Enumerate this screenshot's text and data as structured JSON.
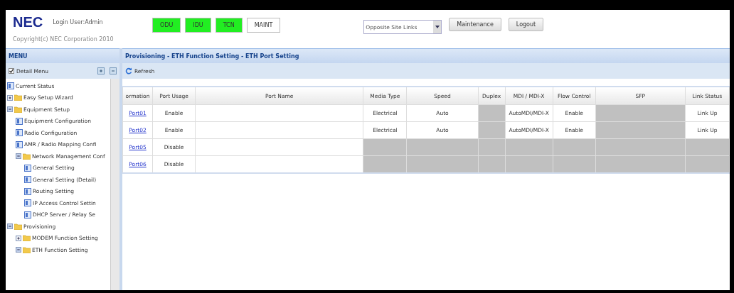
{
  "header": {
    "logo": "NEC",
    "login": "Login User:Admin",
    "copyright": "Copyright(c) NEC Corporation 2010",
    "badges": [
      {
        "label": "ODU",
        "color": "#22ee22"
      },
      {
        "label": "IDU",
        "color": "#22ee22"
      },
      {
        "label": "TCN",
        "color": "#22ee22"
      },
      {
        "label": "MAINT",
        "color": "#ffffff"
      }
    ],
    "site_select": {
      "value": "Opposite Site Links"
    },
    "buttons": [
      "Maintenance",
      "Logout"
    ]
  },
  "sidebar": {
    "title": "MENU",
    "detail_menu": {
      "label": "Detail Menu",
      "checked": true
    },
    "tree": [
      {
        "label": "Current Status",
        "kind": "page"
      },
      {
        "label": "Easy Setup Wizard",
        "kind": "folder",
        "expanded": false
      },
      {
        "label": "Equipment Setup",
        "kind": "folder",
        "expanded": true,
        "children": [
          {
            "label": "Equipment Configuration",
            "kind": "page"
          },
          {
            "label": "Radio Configuration",
            "kind": "page"
          },
          {
            "label": "AMR / Radio Mapping Confi",
            "kind": "page"
          },
          {
            "label": "Network Management Conf",
            "kind": "folder",
            "expanded": true,
            "children": [
              {
                "label": "General Setting",
                "kind": "page"
              },
              {
                "label": "General Setting (Detail)",
                "kind": "page"
              },
              {
                "label": "Routing Setting",
                "kind": "page"
              },
              {
                "label": "IP Access Control Settin",
                "kind": "page"
              },
              {
                "label": "DHCP Server / Relay Se",
                "kind": "page"
              }
            ]
          }
        ]
      },
      {
        "label": "Provisioning",
        "kind": "folder",
        "expanded": true,
        "children": [
          {
            "label": "MODEM Function Setting",
            "kind": "folder",
            "expanded": false
          },
          {
            "label": "ETH Function Setting",
            "kind": "folder",
            "expanded": true
          }
        ]
      }
    ]
  },
  "main": {
    "breadcrumb": "Provisioning - ETH Function Setting - ETH Port Setting",
    "refresh": "Refresh",
    "table": {
      "columns": [
        "ormation",
        "Port Usage",
        "Port Name",
        "Media Type",
        "Speed",
        "Duplex",
        "MDI / MDI-X",
        "Flow Control",
        "SFP",
        "Link Status"
      ],
      "rows": [
        {
          "cells": [
            {
              "text": "Port01",
              "kind": "link"
            },
            {
              "text": "Enable"
            },
            {
              "text": ""
            },
            {
              "text": "Electrical"
            },
            {
              "text": "Auto"
            },
            {
              "disabled": true
            },
            {
              "text": "AutoMDI/MDI-X"
            },
            {
              "text": "Enable"
            },
            {
              "disabled": true
            },
            {
              "text": "Link Up"
            }
          ]
        },
        {
          "cells": [
            {
              "text": "Port02",
              "kind": "link"
            },
            {
              "text": "Enable"
            },
            {
              "text": ""
            },
            {
              "text": "Electrical"
            },
            {
              "text": "Auto"
            },
            {
              "disabled": true
            },
            {
              "text": "AutoMDI/MDI-X"
            },
            {
              "text": "Enable"
            },
            {
              "disabled": true
            },
            {
              "text": "Link Up"
            }
          ]
        },
        {
          "cells": [
            {
              "text": "Port05",
              "kind": "link"
            },
            {
              "text": "Disable"
            },
            {
              "text": ""
            },
            {
              "disabled": true
            },
            {
              "disabled": true
            },
            {
              "disabled": true
            },
            {
              "disabled": true
            },
            {
              "disabled": true
            },
            {
              "disabled": true
            },
            {
              "disabled": true
            }
          ]
        },
        {
          "cells": [
            {
              "text": "Port06",
              "kind": "link"
            },
            {
              "text": "Disable"
            },
            {
              "text": ""
            },
            {
              "disabled": true
            },
            {
              "disabled": true
            },
            {
              "disabled": true
            },
            {
              "disabled": true
            },
            {
              "disabled": true
            },
            {
              "disabled": true
            },
            {
              "disabled": true
            }
          ]
        }
      ]
    }
  }
}
